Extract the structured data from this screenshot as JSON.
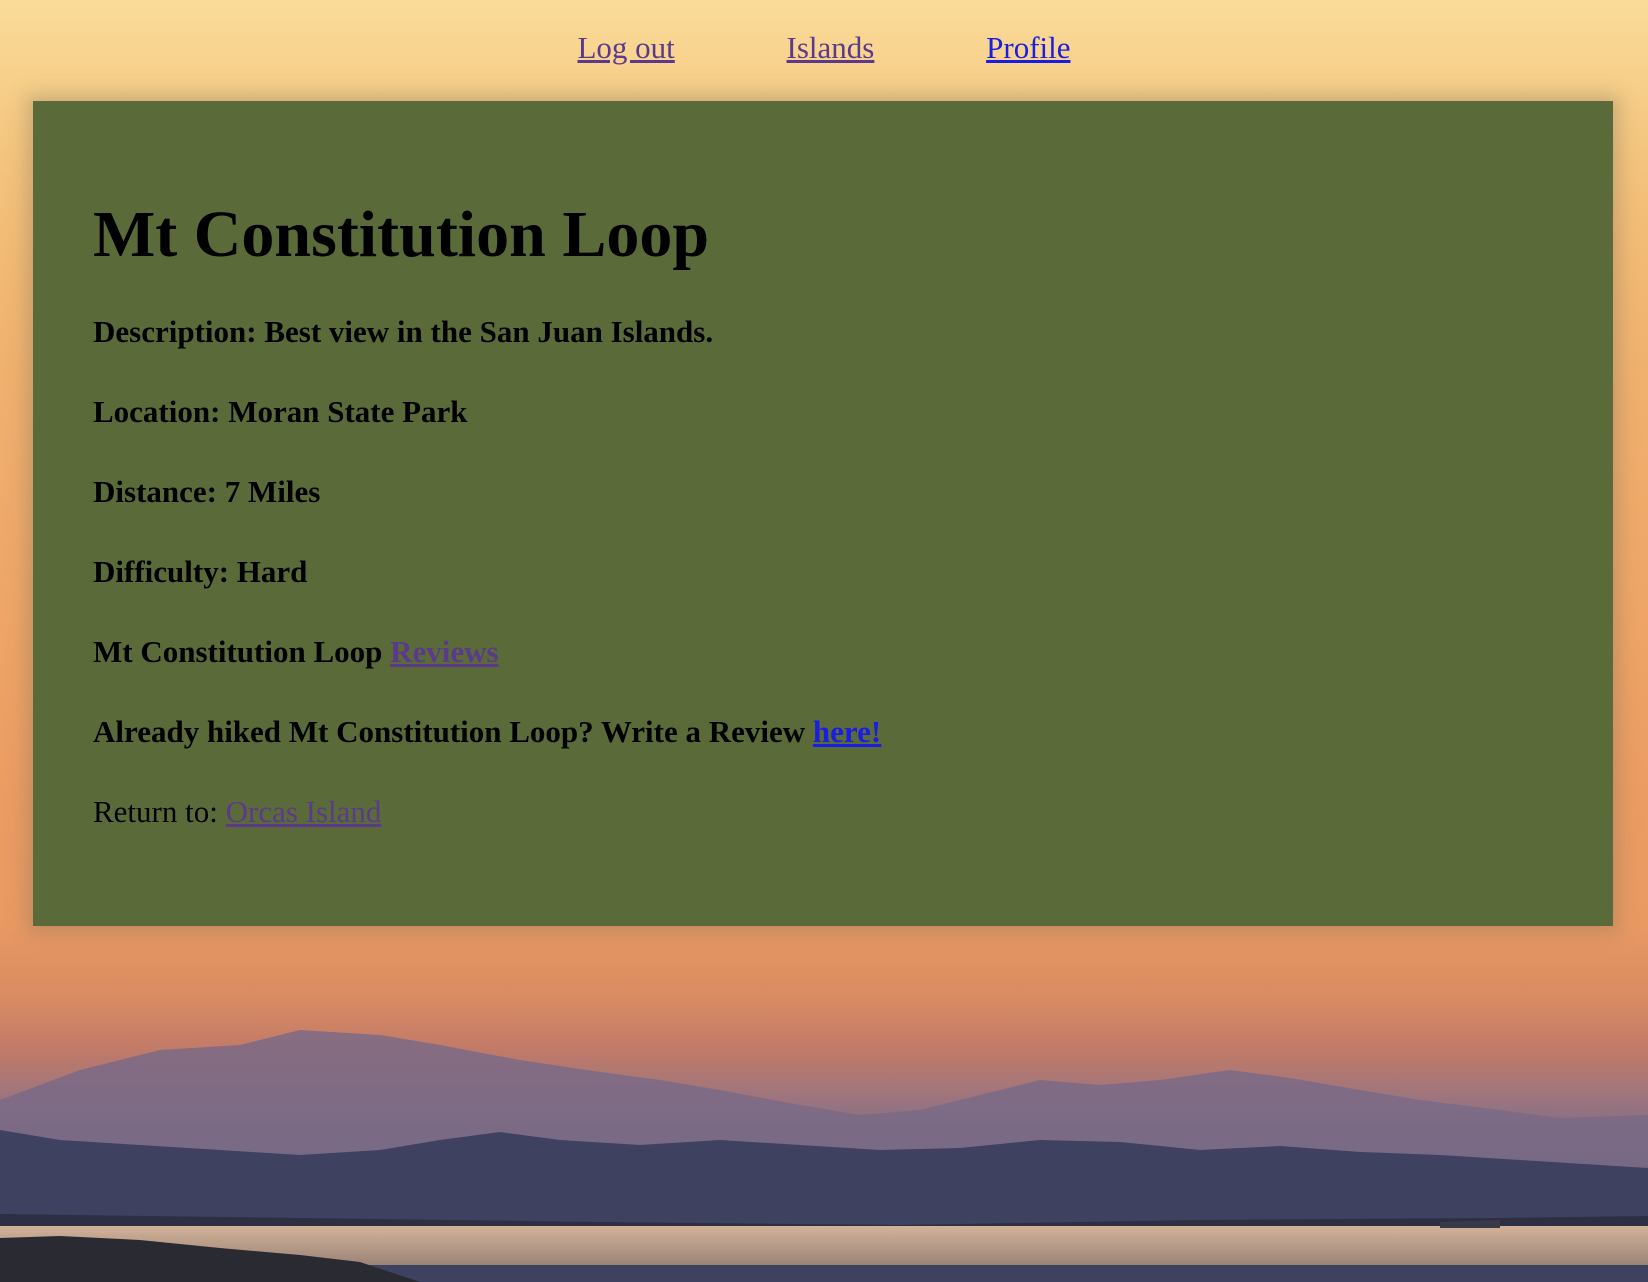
{
  "nav": {
    "logout_label": "Log out",
    "islands_label": "Islands",
    "profile_label": "Profile"
  },
  "trail": {
    "title": "Mt Constitution Loop",
    "description_label": "Description:",
    "description": "Best view in the San Juan Islands.",
    "location_label": "Location:",
    "location": "Moran State Park",
    "distance_label": "Distance:",
    "distance": "7 Miles",
    "difficulty_label": "Difficulty:",
    "difficulty": "Hard",
    "reviews_prefix": "Mt Constitution Loop",
    "reviews_link": "Reviews",
    "write_review_prefix": "Already hiked Mt Constitution Loop? Write a Review",
    "write_review_link": "here!",
    "return_label": "Return to:",
    "return_link": "Orcas Island"
  },
  "colors": {
    "card_background": "#5a6b39",
    "link_visited": "#5b3a8c",
    "link_unvisited": "#1a1ee0"
  }
}
